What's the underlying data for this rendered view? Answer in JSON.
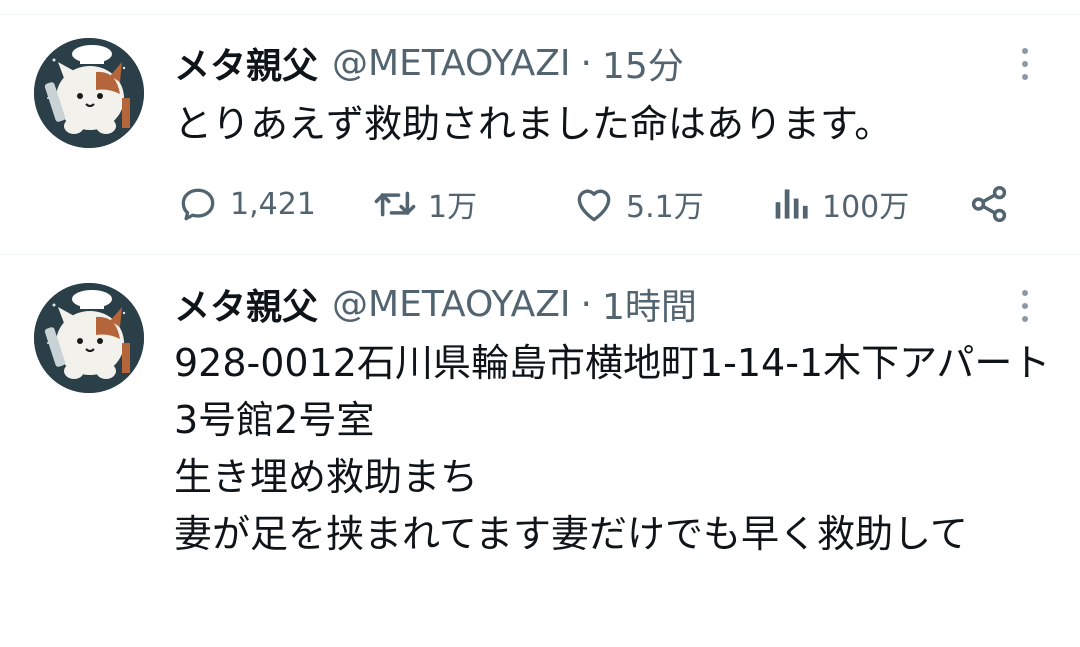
{
  "tweets": [
    {
      "display_name": "メタ親父",
      "handle": "@METAOYAZI",
      "separator": "·",
      "time": "15分",
      "text": "とりあえず救助されました命はあります。",
      "actions": {
        "reply_count": "1,421",
        "retweet_count": "1万",
        "like_count": "5.1万",
        "view_count": "100万"
      },
      "icons": [
        "reply-icon",
        "retweet-icon",
        "like-icon",
        "views-icon",
        "share-icon",
        "more-icon"
      ]
    },
    {
      "display_name": "メタ親父",
      "handle": "@METAOYAZI",
      "separator": "·",
      "time": "1時間",
      "text": "928-0012石川県輪島市横地町1-14-1木下アパート3号館2号室\n生き埋め救助まち\n妻が足を挟まれてます妻だけでも早く救助して",
      "icons": [
        "more-icon"
      ]
    }
  ],
  "colors": {
    "text_primary": "#0f1419",
    "text_secondary": "#536471",
    "divider": "#eff3f4"
  }
}
